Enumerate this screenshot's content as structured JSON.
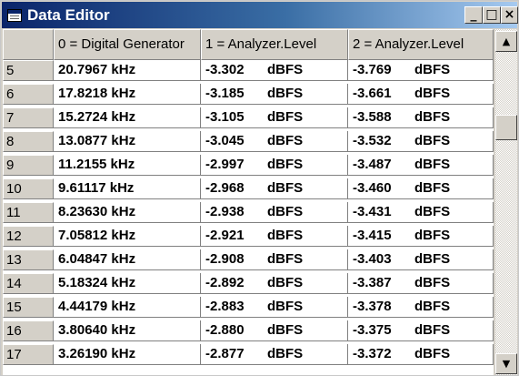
{
  "window": {
    "title": "Data Editor",
    "buttons": {
      "minimize": "_",
      "maximize": "□",
      "close": "×"
    }
  },
  "columns": [
    "",
    "0 = Digital Generator",
    "1 = Analyzer.Level",
    "2 = Analyzer.Level"
  ],
  "unit": "dBFS",
  "rows": [
    {
      "index": "5",
      "freq": "20.7967 kHz",
      "ch1": "-3.302",
      "ch2": "-3.769"
    },
    {
      "index": "6",
      "freq": "17.8218 kHz",
      "ch1": "-3.185",
      "ch2": "-3.661"
    },
    {
      "index": "7",
      "freq": "15.2724 kHz",
      "ch1": "-3.105",
      "ch2": "-3.588"
    },
    {
      "index": "8",
      "freq": "13.0877 kHz",
      "ch1": "-3.045",
      "ch2": "-3.532"
    },
    {
      "index": "9",
      "freq": "11.2155 kHz",
      "ch1": "-2.997",
      "ch2": "-3.487"
    },
    {
      "index": "10",
      "freq": "9.61117 kHz",
      "ch1": "-2.968",
      "ch2": "-3.460"
    },
    {
      "index": "11",
      "freq": "8.23630 kHz",
      "ch1": "-2.938",
      "ch2": "-3.431"
    },
    {
      "index": "12",
      "freq": "7.05812 kHz",
      "ch1": "-2.921",
      "ch2": "-3.415"
    },
    {
      "index": "13",
      "freq": "6.04847 kHz",
      "ch1": "-2.908",
      "ch2": "-3.403"
    },
    {
      "index": "14",
      "freq": "5.18324 kHz",
      "ch1": "-2.892",
      "ch2": "-3.387"
    },
    {
      "index": "15",
      "freq": "4.44179 kHz",
      "ch1": "-2.883",
      "ch2": "-3.378"
    },
    {
      "index": "16",
      "freq": "3.80640 kHz",
      "ch1": "-2.880",
      "ch2": "-3.375"
    },
    {
      "index": "17",
      "freq": "3.26190 kHz",
      "ch1": "-2.877",
      "ch2": "-3.372"
    }
  ],
  "scrollbar": {
    "up_arrow": "▲",
    "down_arrow": "▼"
  },
  "icons": {
    "window_icon": "table-icon"
  },
  "colors": {
    "title_start": "#0a246a",
    "title_end": "#a6caf0",
    "face": "#d4d0c8",
    "title_text": "#ffffff"
  }
}
